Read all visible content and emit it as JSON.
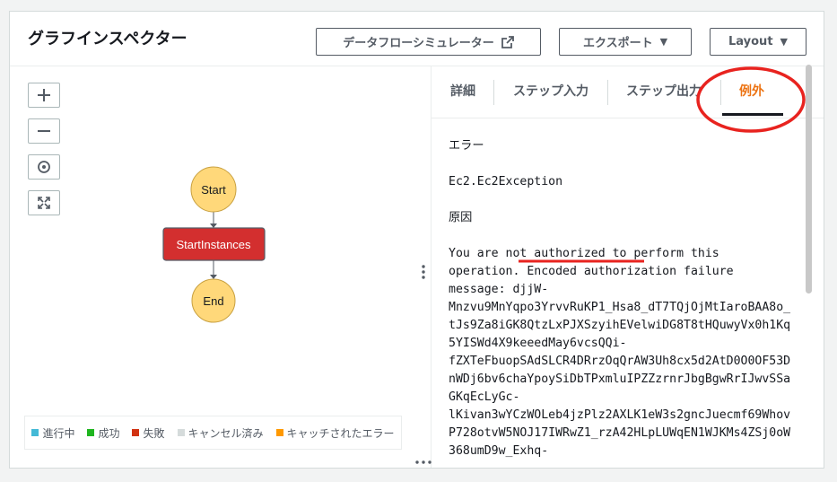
{
  "header": {
    "title": "グラフインスペクター",
    "data_flow_simulator": "データフローシミュレーター",
    "export_label": "エクスポート",
    "layout_label": "Layout"
  },
  "graph": {
    "start": "Start",
    "state": "StartInstances",
    "end": "End",
    "state_status": "失敗"
  },
  "legend": [
    {
      "label": "進行中",
      "color": "#44b9d6"
    },
    {
      "label": "成功",
      "color": "#1fb51f"
    },
    {
      "label": "失敗",
      "color": "#d13212"
    },
    {
      "label": "キャンセル済み",
      "color": "#d5dbdb"
    },
    {
      "label": "キャッチされたエラー",
      "color": "#ff9900"
    }
  ],
  "tabs": [
    "詳細",
    "ステップ入力",
    "ステップ出力",
    "例外"
  ],
  "active_tab": "例外",
  "exception": {
    "error_heading": "エラー",
    "error_value": "Ec2.Ec2Exception",
    "cause_heading": "原因",
    "cause_lines": [
      "You are not authorized to perform this",
      "operation. Encoded authorization failure",
      "message: djjW-",
      "Mnzvu9MnYqpo3YrvvRuKP1_Hsa8_dT7TQjOjMtIaroBAA8o_",
      "tJs9Za8iGK8QtzLxPJXSzyihEVelwiDG8T8tHQuwyVx0h1Kq",
      "5YISWd4X9keeedMay6vcsQQi-",
      "fZXTeFbuopSAdSLCR4DRrzOqQrAW3Uh8cx5d2AtD0O0OF53D",
      "nWDj6bv6chaYpoySiDbTPxmluIPZZzrnrJbgBgwRrIJwvSSa",
      "GKqEcLyGc-",
      "lKivan3wYCzWOLeb4jzPlz2AXLK1eW3s2gncJuecmf69Whov",
      "P728otvW5NOJ17IWRwZ1_rzA42HLpLUWqEN1WJKMs4ZSj0oW",
      "368umD9w_Exhq-"
    ]
  },
  "colors": {
    "annotation": "#e8231f",
    "active_tab": "#ec7211",
    "failed_state": "#d32f2f"
  }
}
